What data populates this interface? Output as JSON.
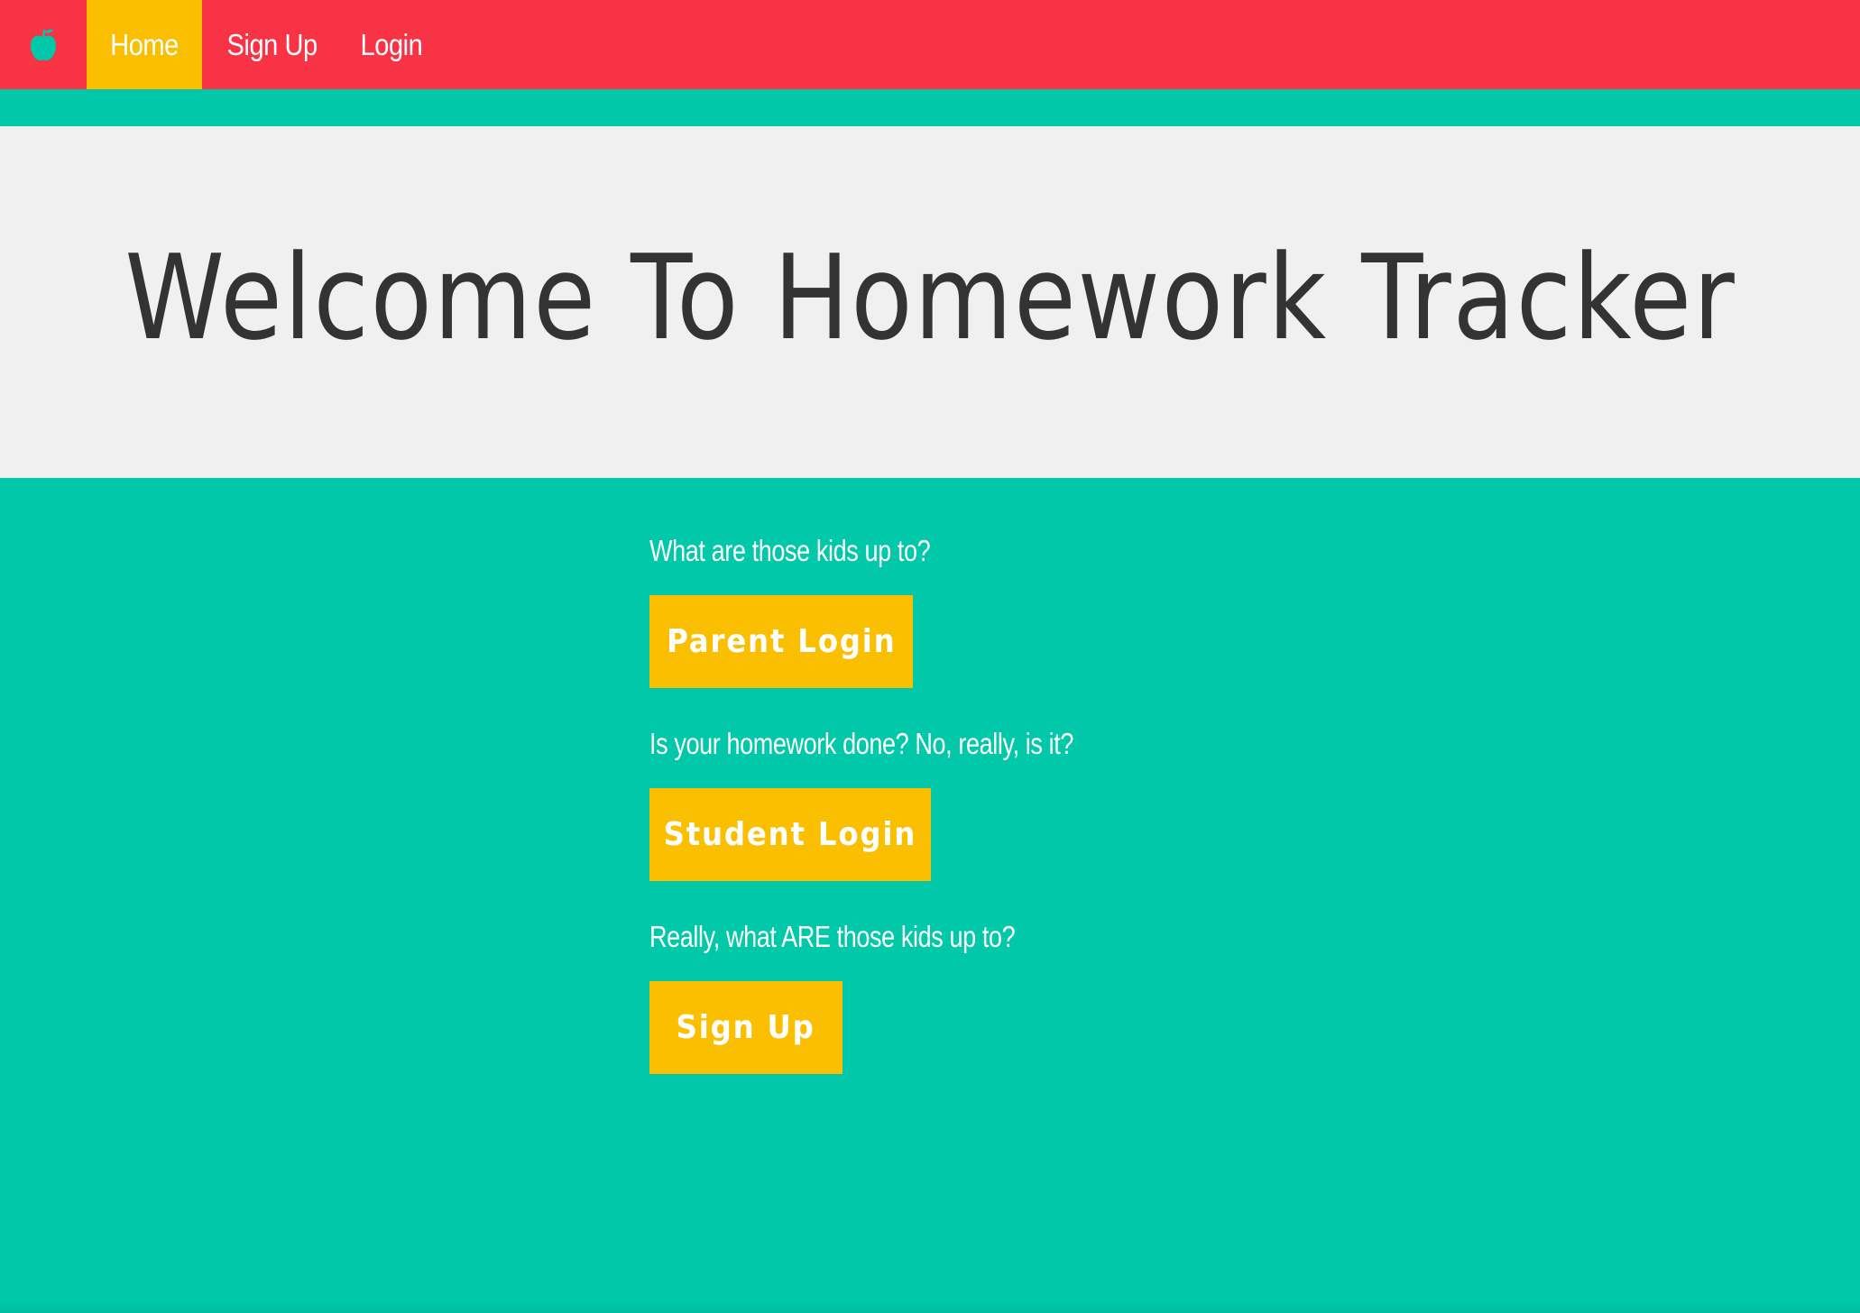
{
  "navbar": {
    "brand_icon": "apple-icon",
    "items": [
      {
        "label": "Home",
        "active": true
      },
      {
        "label": "Sign Up",
        "active": false
      },
      {
        "label": "Login",
        "active": false
      }
    ]
  },
  "hero": {
    "title": "Welcome To Homework Tracker"
  },
  "sections": [
    {
      "prompt": "What are those kids up to?",
      "button": "Parent Login"
    },
    {
      "prompt": "Is your homework done? No, really, is it?",
      "button": "Student Login"
    },
    {
      "prompt": "Really, what ARE those kids up to?",
      "button": "Sign Up"
    }
  ],
  "colors": {
    "navbar": "#f73345",
    "accent": "#f9bf00",
    "teal": "#00c8a8",
    "hero_bg": "#f0f0f0",
    "title_text": "#333333"
  }
}
